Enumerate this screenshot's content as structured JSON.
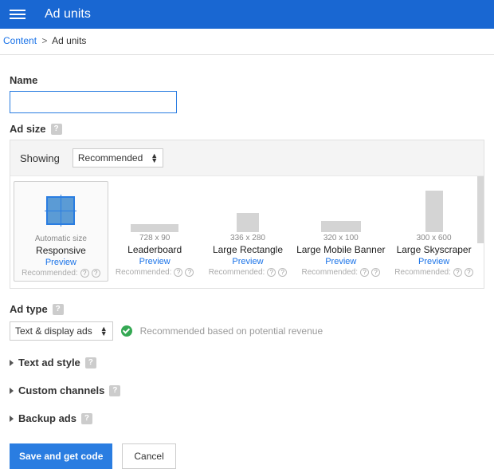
{
  "header": {
    "title": "Ad units"
  },
  "breadcrumb": {
    "root": "Content",
    "sep": ">",
    "current": "Ad units"
  },
  "name": {
    "label": "Name",
    "value": ""
  },
  "adsize": {
    "label": "Ad size",
    "showing_label": "Showing",
    "showing_value": "Recommended",
    "cards": [
      {
        "dims": "Automatic size",
        "name": "Responsive",
        "preview": "Preview",
        "rec": "Recommended:",
        "selected": true,
        "thumb_w": 0,
        "thumb_h": 0,
        "responsive": true
      },
      {
        "dims": "728 x 90",
        "name": "Leaderboard",
        "preview": "Preview",
        "rec": "Recommended:",
        "selected": false,
        "thumb_w": 60,
        "thumb_h": 10,
        "responsive": false
      },
      {
        "dims": "336 x 280",
        "name": "Large Rectangle",
        "preview": "Preview",
        "rec": "Recommended:",
        "selected": false,
        "thumb_w": 28,
        "thumb_h": 24,
        "responsive": false
      },
      {
        "dims": "320 x 100",
        "name": "Large Mobile Banner",
        "preview": "Preview",
        "rec": "Recommended:",
        "selected": false,
        "thumb_w": 50,
        "thumb_h": 14,
        "responsive": false
      },
      {
        "dims": "300 x 600",
        "name": "Large Skyscraper",
        "preview": "Preview",
        "rec": "Recommended:",
        "selected": false,
        "thumb_w": 22,
        "thumb_h": 52,
        "responsive": false
      }
    ]
  },
  "adtype": {
    "label": "Ad type",
    "value": "Text & display ads",
    "note": "Recommended based on potential revenue"
  },
  "collapsibles": [
    {
      "label": "Text ad style"
    },
    {
      "label": "Custom channels"
    },
    {
      "label": "Backup ads"
    }
  ],
  "buttons": {
    "save": "Save and get code",
    "cancel": "Cancel"
  },
  "help_glyph": "?"
}
